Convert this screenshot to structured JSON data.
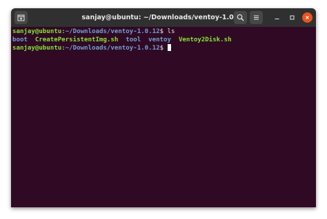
{
  "window": {
    "title": "sanjay@ubuntu: ~/Downloads/ventoy-1.0.12"
  },
  "terminal": {
    "line1": {
      "user_host": "sanjay@ubuntu",
      "sep": ":",
      "path": "~/Downloads/ventoy-1.0.12",
      "prompt": "$ ",
      "command": "ls"
    },
    "listing": {
      "item1": "boot",
      "item2": "CreatePersistentImg.sh",
      "item3": "tool",
      "item4": "ventoy",
      "item5": "Ventoy2Disk.sh"
    },
    "line3": {
      "user_host": "sanjay@ubuntu",
      "sep": ":",
      "path": "~/Downloads/ventoy-1.0.12",
      "prompt": "$ "
    }
  },
  "icons": {
    "newtab": "new-tab-icon",
    "search": "search-icon",
    "menu": "hamburger-menu-icon",
    "minimize": "minimize-icon",
    "maximize": "maximize-icon",
    "close": "close-icon"
  },
  "colors": {
    "terminal_bg": "#300a24",
    "titlebar_bg": "#303030",
    "prompt_user": "#8ae234",
    "prompt_path": "#729fcf",
    "close_button": "#e95420"
  }
}
